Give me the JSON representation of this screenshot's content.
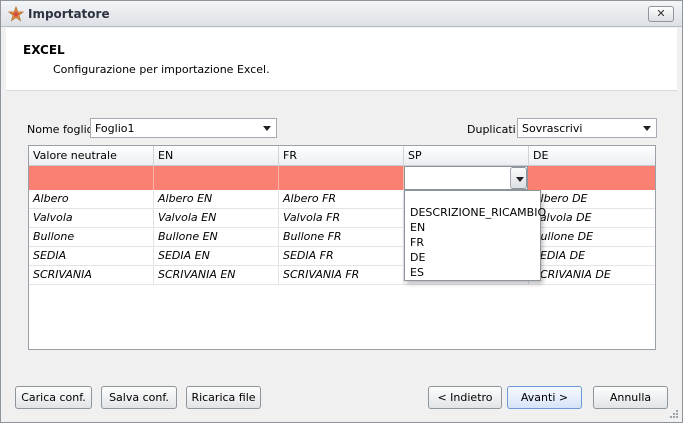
{
  "window": {
    "title": "Importatore",
    "close_label": "✕"
  },
  "header": {
    "title": "EXCEL",
    "subtitle": "Configurazione per importazione Excel."
  },
  "sheet": {
    "label": "Nome foglio:",
    "value": "Foglio1"
  },
  "duplicates": {
    "label": "Duplicati:",
    "value": "Sovrascrivi"
  },
  "grid": {
    "columns": [
      "Valore neutrale",
      "EN",
      "FR",
      "SP",
      "DE"
    ],
    "rows": [
      [
        "Albero",
        "Albero EN",
        "Albero FR",
        "",
        "Albero DE"
      ],
      [
        "Valvola",
        "Valvola EN",
        "Valvola FR",
        "",
        "Valvola DE"
      ],
      [
        "Bullone",
        "Bullone EN",
        "Bullone FR",
        "",
        "Bullone DE"
      ],
      [
        "SEDIA",
        "SEDIA EN",
        "SEDIA FR",
        "",
        "SEDIA DE"
      ],
      [
        "SCRIVANIA",
        "SCRIVANIA EN",
        "SCRIVANIA FR",
        "",
        "SCRIVANIA DE"
      ]
    ],
    "mapping_row_color": "#fa8072"
  },
  "dropdown": {
    "options": [
      "DESCRIZIONE_RICAMBIO",
      "EN",
      "FR",
      "DE",
      "ES"
    ]
  },
  "buttons": {
    "load_conf": "Carica conf.",
    "save_conf": "Salva conf.",
    "reload_file": "Ricarica file",
    "back": "< Indietro",
    "next": "Avanti >",
    "cancel": "Annulla"
  }
}
